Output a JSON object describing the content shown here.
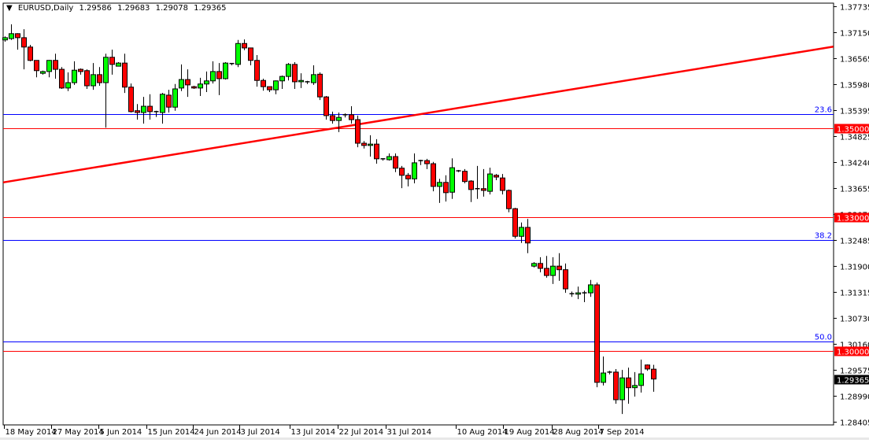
{
  "header": {
    "menu_icon": "triangle-down-icon",
    "symbol": "EURUSD,Daily",
    "open": "1.29586",
    "high": "1.29683",
    "low": "1.29078",
    "close": "1.29365"
  },
  "colors": {
    "bull": "#00ff00",
    "bear": "#ff0000",
    "fib": "#0000ff",
    "level": "#ff0000",
    "trendline": "#ff0000",
    "current_price_bg": "#000000"
  },
  "chart_data": {
    "type": "candlestick",
    "title": "EURUSD,Daily",
    "ylim": [
      1.28405,
      1.37735
    ],
    "y_ticks": [
      "1.37735",
      "1.37150",
      "1.36565",
      "1.35980",
      "1.35395",
      "1.34825",
      "1.34240",
      "1.33655",
      "1.33070",
      "1.32485",
      "1.31900",
      "1.31315",
      "1.30730",
      "1.30160",
      "1.29575",
      "1.28990",
      "1.28405"
    ],
    "x_ticks": [
      {
        "label": "18 May 2014",
        "bar": 0
      },
      {
        "label": "27 May 2014",
        "bar": 7.5
      },
      {
        "label": "5 Jun 2014",
        "bar": 15
      },
      {
        "label": "15 Jun 2014",
        "bar": 22.6
      },
      {
        "label": "24 Jun 2014",
        "bar": 30
      },
      {
        "label": "3 Jul 2014",
        "bar": 37.4
      },
      {
        "label": "13 Jul 2014",
        "bar": 45.4
      },
      {
        "label": "22 Jul 2014",
        "bar": 53
      },
      {
        "label": "31 Jul 2014",
        "bar": 60.6
      },
      {
        "label": "10 Aug 2014",
        "bar": 71.7
      },
      {
        "label": "19 Aug 2014",
        "bar": 79.2
      },
      {
        "label": "28 Aug 2014",
        "bar": 87
      },
      {
        "label": "7 Sep 2014",
        "bar": 94.4
      }
    ],
    "candles_ohlc": [
      [
        1.3698,
        1.3706,
        1.3694,
        1.3703
      ],
      [
        1.3701,
        1.3733,
        1.3698,
        1.3712
      ],
      [
        1.3712,
        1.3713,
        1.3676,
        1.3703
      ],
      [
        1.3703,
        1.3722,
        1.3632,
        1.3682
      ],
      [
        1.3682,
        1.3687,
        1.365,
        1.3652
      ],
      [
        1.3652,
        1.3652,
        1.3614,
        1.3629
      ],
      [
        1.3623,
        1.3629,
        1.362,
        1.3627
      ],
      [
        1.3627,
        1.3653,
        1.3614,
        1.3652
      ],
      [
        1.3652,
        1.3667,
        1.3611,
        1.3632
      ],
      [
        1.3632,
        1.3637,
        1.3588,
        1.359
      ],
      [
        1.359,
        1.3625,
        1.3583,
        1.3602
      ],
      [
        1.3602,
        1.365,
        1.3597,
        1.363
      ],
      [
        1.3632,
        1.3634,
        1.362,
        1.3627
      ],
      [
        1.3629,
        1.3632,
        1.3588,
        1.3595
      ],
      [
        1.3595,
        1.3646,
        1.3586,
        1.362
      ],
      [
        1.362,
        1.3637,
        1.3595,
        1.3602
      ],
      [
        1.3602,
        1.3667,
        1.3501,
        1.3659
      ],
      [
        1.3659,
        1.3676,
        1.362,
        1.3643
      ],
      [
        1.3639,
        1.3648,
        1.3639,
        1.3646
      ],
      [
        1.3646,
        1.3667,
        1.3579,
        1.3592
      ],
      [
        1.3592,
        1.36,
        1.3535,
        1.3537
      ],
      [
        1.3539,
        1.3554,
        1.3519,
        1.3535
      ],
      [
        1.3535,
        1.357,
        1.351,
        1.3549
      ],
      [
        1.3549,
        1.3576,
        1.3519,
        1.3537
      ],
      [
        1.3537,
        1.3539,
        1.3525,
        1.3535
      ],
      [
        1.3535,
        1.3579,
        1.351,
        1.3576
      ],
      [
        1.3574,
        1.3586,
        1.3535,
        1.3547
      ],
      [
        1.3547,
        1.3599,
        1.3539,
        1.3588
      ],
      [
        1.359,
        1.3643,
        1.3583,
        1.3609
      ],
      [
        1.3609,
        1.3632,
        1.357,
        1.3597
      ],
      [
        1.3593,
        1.3595,
        1.3588,
        1.359
      ],
      [
        1.359,
        1.3613,
        1.3572,
        1.3599
      ],
      [
        1.3599,
        1.3627,
        1.3581,
        1.3606
      ],
      [
        1.3606,
        1.365,
        1.36,
        1.3627
      ],
      [
        1.3627,
        1.3646,
        1.3574,
        1.3611
      ],
      [
        1.3611,
        1.3648,
        1.3609,
        1.3646
      ],
      [
        1.3645,
        1.3646,
        1.3641,
        1.3643
      ],
      [
        1.3643,
        1.3698,
        1.3637,
        1.369
      ],
      [
        1.369,
        1.3699,
        1.3675,
        1.368
      ],
      [
        1.368,
        1.368,
        1.3641,
        1.3652
      ],
      [
        1.3652,
        1.3664,
        1.3593,
        1.3607
      ],
      [
        1.3607,
        1.3611,
        1.3584,
        1.3593
      ],
      [
        1.3593,
        1.3593,
        1.3581,
        1.3586
      ],
      [
        1.3586,
        1.3607,
        1.3576,
        1.3606
      ],
      [
        1.3606,
        1.3618,
        1.3588,
        1.3616
      ],
      [
        1.3616,
        1.3646,
        1.3607,
        1.3643
      ],
      [
        1.3643,
        1.3648,
        1.3588,
        1.3604
      ],
      [
        1.3604,
        1.3623,
        1.359,
        1.3607
      ],
      [
        1.3604,
        1.3606,
        1.3599,
        1.3602
      ],
      [
        1.3602,
        1.3641,
        1.3597,
        1.362
      ],
      [
        1.3621,
        1.3625,
        1.3563,
        1.357
      ],
      [
        1.357,
        1.3572,
        1.3519,
        1.3528
      ],
      [
        1.3528,
        1.3537,
        1.351,
        1.3517
      ],
      [
        1.3517,
        1.3535,
        1.3491,
        1.3524
      ],
      [
        1.3529,
        1.3533,
        1.3524,
        1.353
      ],
      [
        1.353,
        1.3549,
        1.351,
        1.3519
      ],
      [
        1.3519,
        1.3528,
        1.3457,
        1.3466
      ],
      [
        1.3466,
        1.3471,
        1.3454,
        1.3461
      ],
      [
        1.3461,
        1.3484,
        1.3436,
        1.3464
      ],
      [
        1.3464,
        1.3475,
        1.342,
        1.3431
      ],
      [
        1.3431,
        1.3432,
        1.3427,
        1.3429
      ],
      [
        1.3429,
        1.3443,
        1.3427,
        1.3436
      ],
      [
        1.3436,
        1.3443,
        1.3401,
        1.341
      ],
      [
        1.341,
        1.3415,
        1.3365,
        1.3394
      ],
      [
        1.3394,
        1.3399,
        1.3369,
        1.3386
      ],
      [
        1.3386,
        1.3443,
        1.3376,
        1.3422
      ],
      [
        1.3427,
        1.3429,
        1.3417,
        1.3425
      ],
      [
        1.3427,
        1.3431,
        1.3408,
        1.342
      ],
      [
        1.342,
        1.3424,
        1.3358,
        1.3369
      ],
      [
        1.3369,
        1.3386,
        1.3332,
        1.3378
      ],
      [
        1.3378,
        1.3394,
        1.3335,
        1.3355
      ],
      [
        1.3356,
        1.3432,
        1.3341,
        1.3411
      ],
      [
        1.3404,
        1.3406,
        1.3401,
        1.3403
      ],
      [
        1.3403,
        1.3408,
        1.3376,
        1.338
      ],
      [
        1.3381,
        1.3383,
        1.3334,
        1.3362
      ],
      [
        1.3362,
        1.3415,
        1.3341,
        1.3364
      ],
      [
        1.3364,
        1.3408,
        1.3346,
        1.336
      ],
      [
        1.3358,
        1.3411,
        1.3351,
        1.3397
      ],
      [
        1.3394,
        1.3397,
        1.3383,
        1.339
      ],
      [
        1.3388,
        1.3397,
        1.3351,
        1.336
      ],
      [
        1.336,
        1.3362,
        1.3311,
        1.3319
      ],
      [
        1.3319,
        1.3321,
        1.3252,
        1.3257
      ],
      [
        1.3257,
        1.3288,
        1.3242,
        1.3277
      ],
      [
        1.3277,
        1.3296,
        1.3219,
        1.3242
      ],
      [
        1.319,
        1.3199,
        1.3187,
        1.3196
      ],
      [
        1.3196,
        1.321,
        1.3176,
        1.3185
      ],
      [
        1.3185,
        1.3213,
        1.3164,
        1.3169
      ],
      [
        1.3169,
        1.321,
        1.315,
        1.319
      ],
      [
        1.319,
        1.3219,
        1.3157,
        1.3182
      ],
      [
        1.3182,
        1.3196,
        1.313,
        1.3139
      ],
      [
        1.3128,
        1.3133,
        1.3121,
        1.3128
      ],
      [
        1.3127,
        1.3144,
        1.3116,
        1.313
      ],
      [
        1.313,
        1.3135,
        1.3109,
        1.313
      ],
      [
        1.313,
        1.3159,
        1.3121,
        1.3148
      ],
      [
        1.3148,
        1.3153,
        1.2918,
        1.2929
      ],
      [
        1.2929,
        1.2987,
        1.2922,
        1.295
      ],
      [
        1.2951,
        1.2955,
        1.2947,
        1.2952
      ],
      [
        1.2952,
        1.2959,
        1.2881,
        1.289
      ],
      [
        1.289,
        1.2957,
        1.2858,
        1.2939
      ],
      [
        1.2939,
        1.2962,
        1.2881,
        1.2917
      ],
      [
        1.2917,
        1.2952,
        1.2897,
        1.2922
      ],
      [
        1.2922,
        1.298,
        1.2906,
        1.2948
      ],
      [
        1.2968,
        1.2969,
        1.2955,
        1.2959
      ],
      [
        1.29586,
        1.29683,
        1.29078,
        1.29365
      ]
    ],
    "horizontal_levels": [
      {
        "price": 1.35,
        "label": "1.35000"
      },
      {
        "price": 1.33,
        "label": "1.33000"
      },
      {
        "price": 1.3,
        "label": "1.30000"
      }
    ],
    "fibonacci_levels": [
      {
        "price": 1.3531,
        "label": "23.6"
      },
      {
        "price": 1.3249,
        "label": "38.2"
      },
      {
        "price": 1.302,
        "label": "50.0"
      }
    ],
    "trendline": {
      "start_bar": -0.25,
      "start_price": 1.3378,
      "end_bar": 131.6,
      "end_price": 1.3683
    },
    "current_price": {
      "price": 1.29365,
      "label": "1.29365"
    }
  }
}
